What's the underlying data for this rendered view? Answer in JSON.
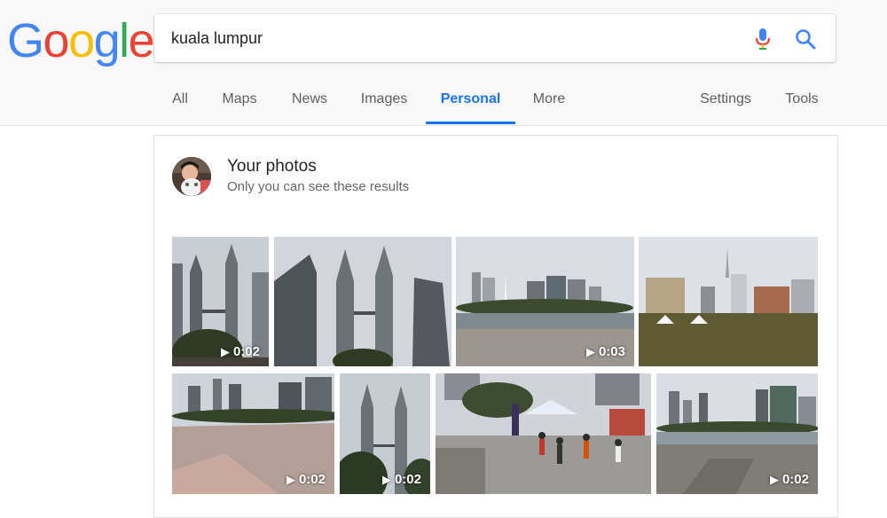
{
  "logo": {
    "letters": [
      "G",
      "o",
      "o",
      "g",
      "l",
      "e"
    ],
    "colors": [
      "#4285F4",
      "#EA4335",
      "#FBBC05",
      "#4285F4",
      "#34A853",
      "#EA4335"
    ]
  },
  "search": {
    "query": "kuala lumpur"
  },
  "icons": {
    "mic": "microphone-icon",
    "search": "search-icon"
  },
  "nav": {
    "tabs": [
      {
        "label": "All"
      },
      {
        "label": "Maps"
      },
      {
        "label": "News"
      },
      {
        "label": "Images"
      },
      {
        "label": "Personal"
      },
      {
        "label": "More"
      }
    ],
    "active_tab": "Personal",
    "settings_label": "Settings",
    "tools_label": "Tools"
  },
  "accent_color": "#1a73e8",
  "result_card": {
    "title": "Your photos",
    "subtitle": "Only you can see these results",
    "photos_row1": [
      {
        "subject": "petronas-towers",
        "duration": "0:02"
      },
      {
        "subject": "petronas-towers-wide",
        "duration": ""
      },
      {
        "subject": "fountain-plaza",
        "duration": "0:03"
      },
      {
        "subject": "merdeka-square",
        "duration": ""
      }
    ],
    "photos_row2": [
      {
        "subject": "klcc-park-walkway",
        "duration": "0:02"
      },
      {
        "subject": "petronas-towers-trees",
        "duration": "0:02"
      },
      {
        "subject": "crowd-plaza",
        "duration": ""
      },
      {
        "subject": "lake-promenade",
        "duration": "0:02"
      }
    ]
  }
}
